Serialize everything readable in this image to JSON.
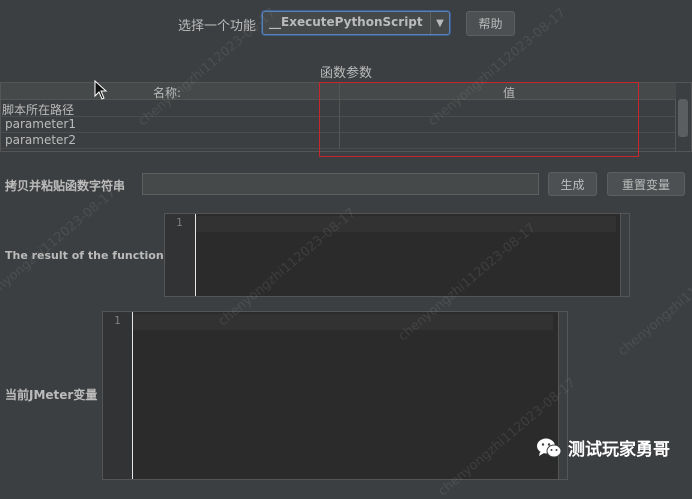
{
  "toolbar": {
    "function_label": "选择一个功能",
    "function_value": "__ExecutePythonScript",
    "help_button": "帮助"
  },
  "params": {
    "section_title": "函数参数",
    "columns": [
      "名称:",
      "值"
    ],
    "rows": [
      {
        "name": "脚本所在路径",
        "value": ""
      },
      {
        "name": "parameter1",
        "value": ""
      },
      {
        "name": "parameter2",
        "value": ""
      }
    ]
  },
  "copy": {
    "label": "拷贝并粘贴函数字符串",
    "value": "",
    "generate_button": "生成",
    "reset_button": "重置变量"
  },
  "result": {
    "label": "The result of the function is",
    "line_number": "1"
  },
  "jmeter_vars": {
    "label": "当前JMeter变量",
    "line_number": "1"
  },
  "watermark": {
    "text": "chenyongzhi112023-08-17"
  },
  "brand": {
    "text": "测试玩家勇哥",
    "icon": "wechat-icon"
  },
  "colors": {
    "highlight_border": "#c8252c",
    "combo_border": "#5a80b8"
  }
}
